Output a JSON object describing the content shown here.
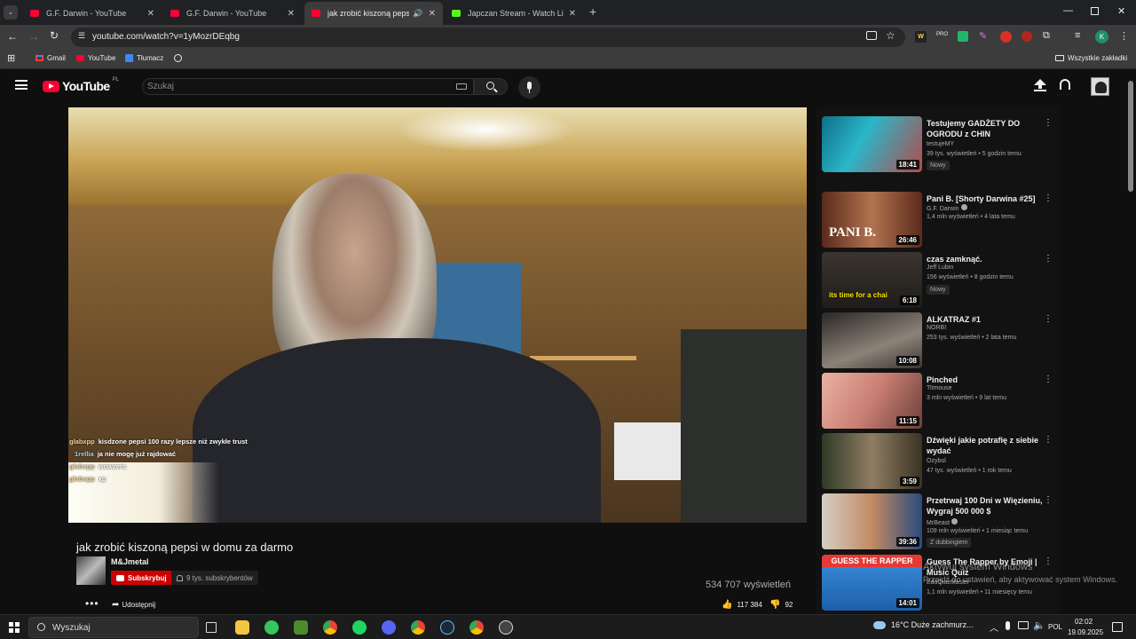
{
  "browser": {
    "tabs": [
      {
        "title": "G.F. Darwin - YouTube",
        "active": false
      },
      {
        "title": "G.F. Darwin - YouTube",
        "active": false
      },
      {
        "title": "jak zrobić kiszoną pepsi w d",
        "active": true
      },
      {
        "title": "Japczan Stream - Watch Live on",
        "active": false
      }
    ],
    "new_tab": "+",
    "url": "youtube.com/watch?v=1yMozrDEqbg",
    "bookmarks": [
      {
        "label": "Gmail"
      },
      {
        "label": "YouTube"
      },
      {
        "label": "Tłumacz"
      }
    ],
    "all_bookmarks": "Wszystkie zakładki",
    "profile_initial": "K"
  },
  "youtube": {
    "logo": "YouTube",
    "region": "PL",
    "search_placeholder": "Szukaj",
    "chat": [
      {
        "user": "glabxpp",
        "text": "kisdzone pepsi 100 razy lepsze niż zwykłe trust"
      },
      {
        "user": "1rellia",
        "text": "ja nie mogę już rajdować"
      },
      {
        "user": "glabxpp",
        "text": "wowzers"
      },
      {
        "user": "glabxpp",
        "text": "xp"
      }
    ],
    "video": {
      "title": "jak zrobić kiszoną pepsi w domu za darmo",
      "channel": "M&Jmetal",
      "subscribers": "9 tys. subskrybentów",
      "subscribe_label": "Subskrybuj",
      "share_label": "Udostępnij",
      "views": "534 707 wyświetleń",
      "likes": "117 384",
      "dislikes": "92"
    },
    "recommended": [
      {
        "title": "Testujemy GADŻETY DO OGRODU z CHIN",
        "channel": "testujeMY",
        "meta": "39 tys. wyświetleń • 5 godzin temu",
        "badge": "Nowy",
        "duration": "18:41",
        "thumb_color": "#0e6f86"
      },
      {
        "title": "Pani B. [Shorty Darwina #25]",
        "channel": "G.F. Darwin",
        "meta": "1,4 mln wyświetleń • 4 lata temu",
        "badge": "",
        "duration": "26:46",
        "thumb_color": "#6e2e1c",
        "thumb_text": "PANI B."
      },
      {
        "title": "czas zamknąć.",
        "channel": "Jeff Lubin",
        "meta": "156 wyświetleń • 8 godzin temu",
        "badge": "Nowy",
        "duration": "6:18",
        "thumb_color": "#2d2a26",
        "thumb_text": "its time for a chai"
      },
      {
        "title": "ALKATRAZ #1",
        "channel": "NORBI",
        "meta": "253 tys. wyświetleń • 2 lata temu",
        "badge": "",
        "duration": "10:08",
        "thumb_color": "#6b625a"
      },
      {
        "title": "Pinched",
        "channel": "Titmouse",
        "meta": "3 mln wyświetleń • 9 lat temu",
        "badge": "",
        "duration": "11:15",
        "thumb_color": "#c9968b"
      },
      {
        "title": "Dźwięki jakie potrafię z siebie wydać",
        "channel": "Ozybol",
        "meta": "47 tys. wyświetleń • 1 rok temu",
        "badge": "",
        "duration": "3:59",
        "thumb_color": "#4a4234"
      },
      {
        "title": "Przetrwaj 100 Dni w Więzieniu, Wygraj 500 000 $",
        "channel": "MrBeast",
        "meta": "109 mln wyświetleń • 1 miesiąc temu",
        "badge": "Z dubbingiem",
        "duration": "39:36",
        "thumb_color": "#2a4b7c"
      },
      {
        "title": "Guess The Rapper by Emoji | Music Quiz",
        "channel": "EduQuizMaster",
        "meta": "1,1 mln wyświetleń • 11 miesięcy temu",
        "badge": "",
        "duration": "14:01",
        "thumb_color": "#2d7fd1",
        "thumb_text": "GUESS THE RAPPER"
      }
    ],
    "windows_watermark_1": "Aktywuj system Windows",
    "windows_watermark_2": "Przejdź do ustawień, aby aktywować system Windows."
  },
  "taskbar": {
    "search_placeholder": "Wyszukaj",
    "weather": "16°C  Duże zachmurz...",
    "language": "POL",
    "time": "02:02",
    "date": "19.09.2025"
  },
  "colors": {
    "yt_red": "#ff0033",
    "bg": "#0f0f0f",
    "like_blue": "#3ea6ff"
  }
}
